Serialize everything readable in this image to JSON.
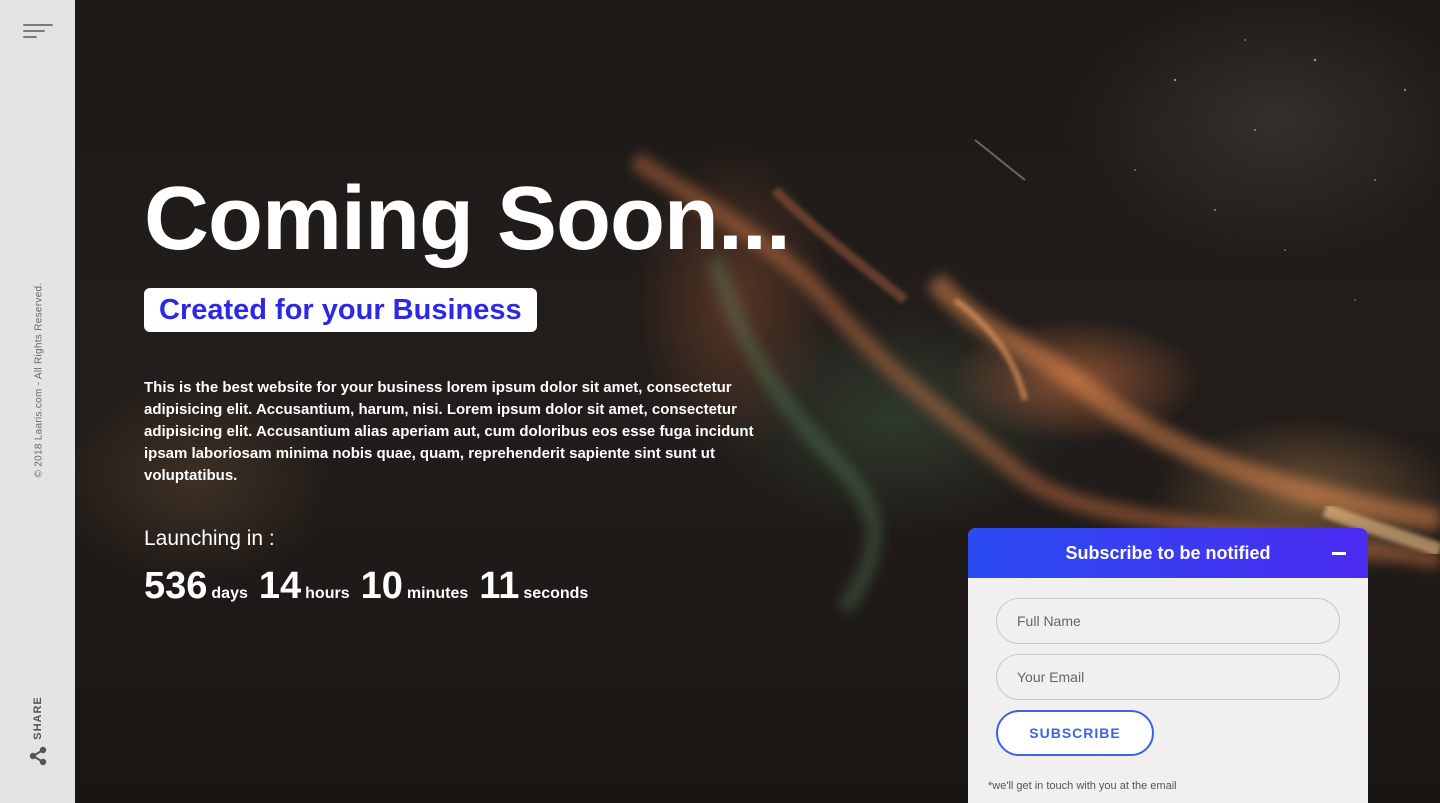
{
  "sidebar": {
    "copyright": "© 2018 Laaris.com - All Rights Reserved.",
    "share_label": "SHARE"
  },
  "hero": {
    "title": "Coming Soon...",
    "tagline": "Created for your Business",
    "description": "This is the best website for your business lorem ipsum dolor sit amet, consectetur adipisicing elit. Accusantium, harum, nisi. Lorem ipsum dolor sit amet, consectetur adipisicing elit. Accusantium alias aperiam aut, cum doloribus eos esse fuga incidunt ipsam laboriosam minima nobis quae, quam, reprehenderit sapiente sint sunt ut voluptatibus."
  },
  "countdown": {
    "label": "Launching in :",
    "days": "536",
    "days_label": "days",
    "hours": "14",
    "hours_label": "hours",
    "minutes": "10",
    "minutes_label": "minutes",
    "seconds": "11",
    "seconds_label": "seconds"
  },
  "subscribe": {
    "title": "Subscribe to be notified",
    "name_placeholder": "Full Name",
    "email_placeholder": "Your Email",
    "button_label": "SUBSCRIBE",
    "note": "*we'll get in touch with you at the email"
  },
  "colors": {
    "accent": "#2c29e6",
    "panel_gradient_start": "#2a4bf2",
    "panel_gradient_end": "#4b2bf0",
    "button_border": "#3d63e6"
  }
}
